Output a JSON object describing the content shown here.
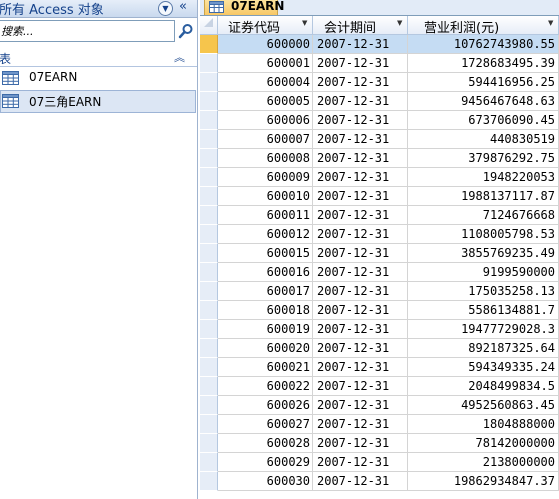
{
  "nav_pane": {
    "title": "所有 Access 对象",
    "menu_icon": "chevron-down-circle-icon",
    "collapse_icon": "double-chevron-left-icon",
    "search": {
      "placeholder": "搜索...",
      "value": ""
    },
    "group": {
      "label": "表",
      "collapse_icon": "double-chevron-up-icon"
    },
    "items": [
      {
        "label": "07EARN",
        "icon": "table-icon"
      },
      {
        "label": "07三角EARN",
        "icon": "table-icon"
      }
    ]
  },
  "document_tab": {
    "label": "07EARN",
    "icon": "table-icon"
  },
  "datasheet": {
    "columns": [
      "证券代码",
      "会计期间",
      "营业利润(元)"
    ],
    "rows": [
      [
        "600000",
        "2007-12-31",
        "10762743980.55"
      ],
      [
        "600001",
        "2007-12-31",
        "1728683495.39"
      ],
      [
        "600004",
        "2007-12-31",
        "594416956.25"
      ],
      [
        "600005",
        "2007-12-31",
        "9456467648.63"
      ],
      [
        "600006",
        "2007-12-31",
        "673706090.45"
      ],
      [
        "600007",
        "2007-12-31",
        "440830519"
      ],
      [
        "600008",
        "2007-12-31",
        "379876292.75"
      ],
      [
        "600009",
        "2007-12-31",
        "1948220053"
      ],
      [
        "600010",
        "2007-12-31",
        "1988137117.87"
      ],
      [
        "600011",
        "2007-12-31",
        "7124676668"
      ],
      [
        "600012",
        "2007-12-31",
        "1108005798.53"
      ],
      [
        "600015",
        "2007-12-31",
        "3855769235.49"
      ],
      [
        "600016",
        "2007-12-31",
        "9199590000"
      ],
      [
        "600017",
        "2007-12-31",
        "175035258.13"
      ],
      [
        "600018",
        "2007-12-31",
        "5586134881.7"
      ],
      [
        "600019",
        "2007-12-31",
        "19477729028.3"
      ],
      [
        "600020",
        "2007-12-31",
        "892187325.64"
      ],
      [
        "600021",
        "2007-12-31",
        "594349335.24"
      ],
      [
        "600022",
        "2007-12-31",
        "2048499834.5"
      ],
      [
        "600026",
        "2007-12-31",
        "4952560863.45"
      ],
      [
        "600027",
        "2007-12-31",
        "1804888000"
      ],
      [
        "600028",
        "2007-12-31",
        "78142000000"
      ],
      [
        "600029",
        "2007-12-31",
        "2138000000"
      ],
      [
        "600030",
        "2007-12-31",
        "19862934847.37"
      ]
    ],
    "current_row": 0
  }
}
